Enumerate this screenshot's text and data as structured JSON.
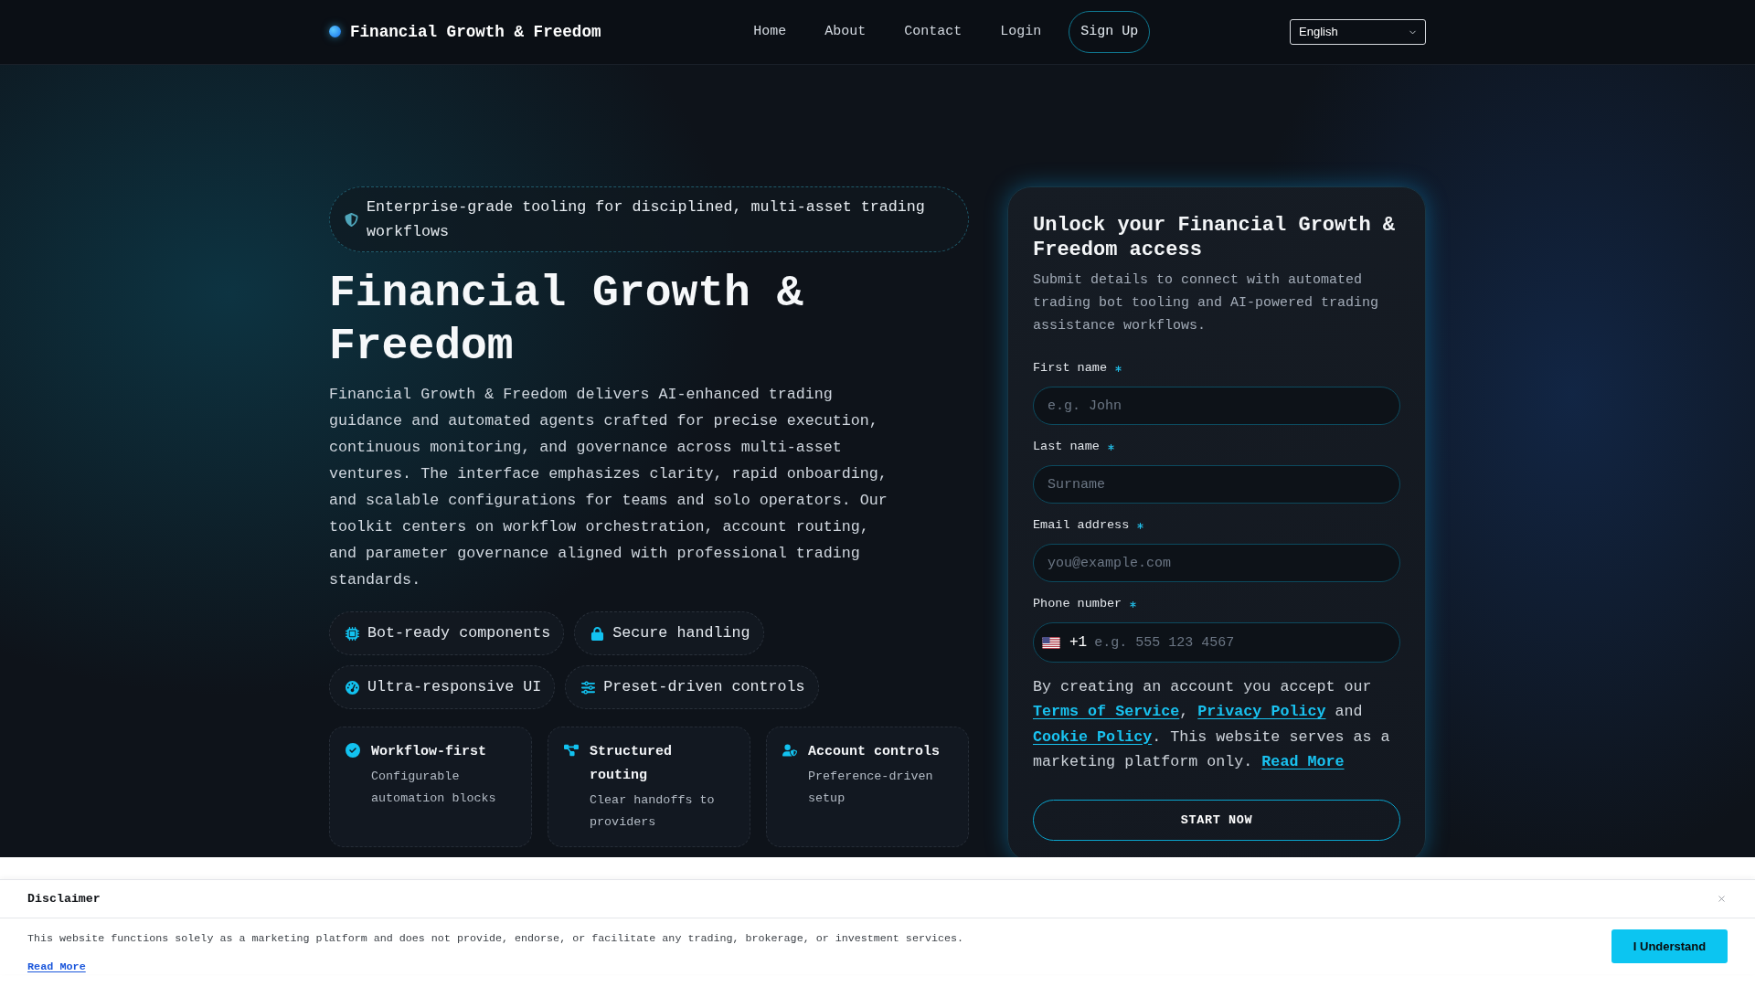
{
  "header": {
    "logo": "Financial Growth & Freedom",
    "nav": [
      {
        "label": "Home",
        "kind": "link"
      },
      {
        "label": "About",
        "kind": "link"
      },
      {
        "label": "Contact",
        "kind": "link"
      },
      {
        "label": "Login",
        "kind": "link"
      },
      {
        "label": "Sign Up",
        "kind": "button"
      }
    ],
    "language": "English"
  },
  "hero": {
    "tagline": "Enterprise-grade tooling for disciplined, multi-asset trading workflows",
    "title": "Financial Growth & Freedom",
    "description": "Financial Growth & Freedom delivers AI-enhanced trading guidance and automated agents crafted for precise execution, continuous monitoring, and governance across multi-asset ventures. The interface emphasizes clarity, rapid onboarding, and scalable configurations for teams and solo operators. Our toolkit centers on workflow orchestration, account routing, and parameter governance aligned with professional trading standards.",
    "features": [
      "Bot-ready components",
      "Secure handling",
      "Ultra-responsive UI",
      "Preset-driven controls"
    ],
    "cards": [
      {
        "title": "Workflow-first",
        "description": "Configurable automation blocks"
      },
      {
        "title": "Structured routing",
        "description": "Clear handoffs to providers"
      },
      {
        "title": "Account controls",
        "description": "Preference-driven setup"
      }
    ]
  },
  "signup_form": {
    "title": "Unlock your Financial Growth & Freedom access",
    "subtitle": "Submit details to connect with automated trading bot tooling and AI-powered trading assistance workflows.",
    "fields": [
      {
        "kind": "text",
        "label": "First name",
        "required": true,
        "placeholder": "e.g. John"
      },
      {
        "kind": "text",
        "label": "Last name",
        "required": true,
        "placeholder": "Surname"
      },
      {
        "kind": "text",
        "label": "Email address",
        "required": true,
        "placeholder": "you@example.com"
      },
      {
        "kind": "phone",
        "label": "Phone number",
        "required": true,
        "country_code": "+1",
        "placeholder": "e.g. 555 123 4567"
      }
    ],
    "consent": [
      {
        "kind": "text",
        "text": "By creating an account you accept our "
      },
      {
        "kind": "link",
        "text": "Terms of Service"
      },
      {
        "kind": "text",
        "text": ", "
      },
      {
        "kind": "link",
        "text": "Privacy Policy"
      },
      {
        "kind": "text",
        "text": " and "
      },
      {
        "kind": "link",
        "text": "Cookie Policy"
      },
      {
        "kind": "text",
        "text": ". This website serves as a marketing platform only. "
      },
      {
        "kind": "link",
        "text": "Read More"
      }
    ],
    "submit": "START NOW"
  },
  "disclaimer": {
    "title": "Disclaimer",
    "text": "This website functions solely as a marketing platform and does not provide, endorse, or facilitate any trading, brokerage, or investment services.",
    "link": "Read More",
    "button": "I Understand"
  }
}
